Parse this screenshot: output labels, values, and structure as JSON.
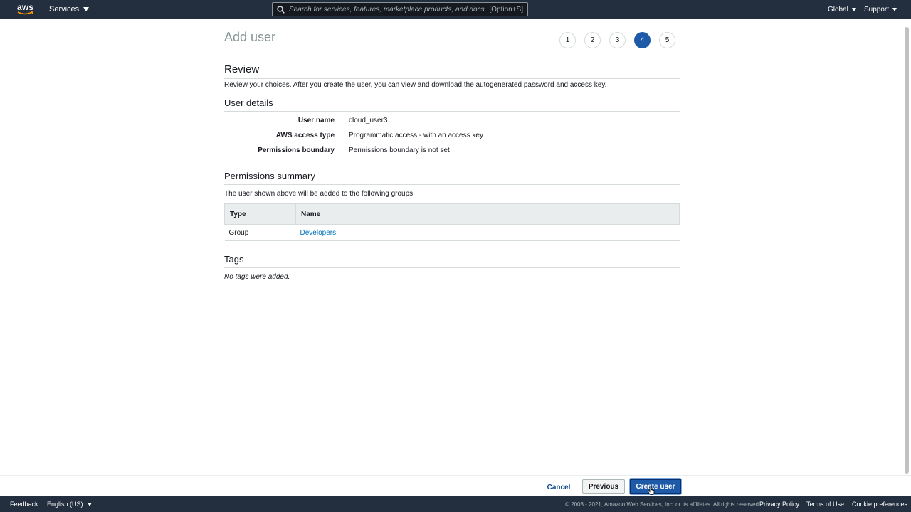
{
  "topnav": {
    "logo": "aws",
    "services_label": "Services",
    "search_placeholder": "Search for services, features, marketplace products, and docs",
    "search_shortcut": "[Option+S]",
    "region_label": "Global",
    "support_label": "Support"
  },
  "page": {
    "title": "Add user",
    "steps": [
      "1",
      "2",
      "3",
      "4",
      "5"
    ],
    "active_step": "4"
  },
  "review": {
    "heading": "Review",
    "description": "Review your choices. After you create the user, you can view and download the autogenerated password and access key."
  },
  "user_details": {
    "heading": "User details",
    "rows": [
      {
        "label": "User name",
        "value": "cloud_user3"
      },
      {
        "label": "AWS access type",
        "value": "Programmatic access - with an access key"
      },
      {
        "label": "Permissions boundary",
        "value": "Permissions boundary is not set"
      }
    ]
  },
  "permissions": {
    "heading": "Permissions summary",
    "description": "The user shown above will be added to the following groups.",
    "columns": [
      "Type",
      "Name"
    ],
    "rows": [
      {
        "type": "Group",
        "name": "Developers"
      }
    ]
  },
  "tags": {
    "heading": "Tags",
    "empty_text": "No tags were added."
  },
  "actions": {
    "cancel": "Cancel",
    "previous": "Previous",
    "create": "Create user"
  },
  "footer": {
    "feedback": "Feedback",
    "language": "English (US)",
    "copyright": "© 2008 - 2021, Amazon Web Services, Inc. or its affiliates. All rights reserved.",
    "privacy": "Privacy Policy",
    "terms": "Terms of Use",
    "cookies": "Cookie preferences"
  },
  "colors": {
    "nav_bg": "#232f3e",
    "accent": "#1e5aa8",
    "link": "#0073bb",
    "logo_smile": "#ff9900"
  },
  "icons": {
    "search": "search-icon",
    "caret": "caret-down-icon",
    "pointer": "hand-pointer-icon"
  }
}
